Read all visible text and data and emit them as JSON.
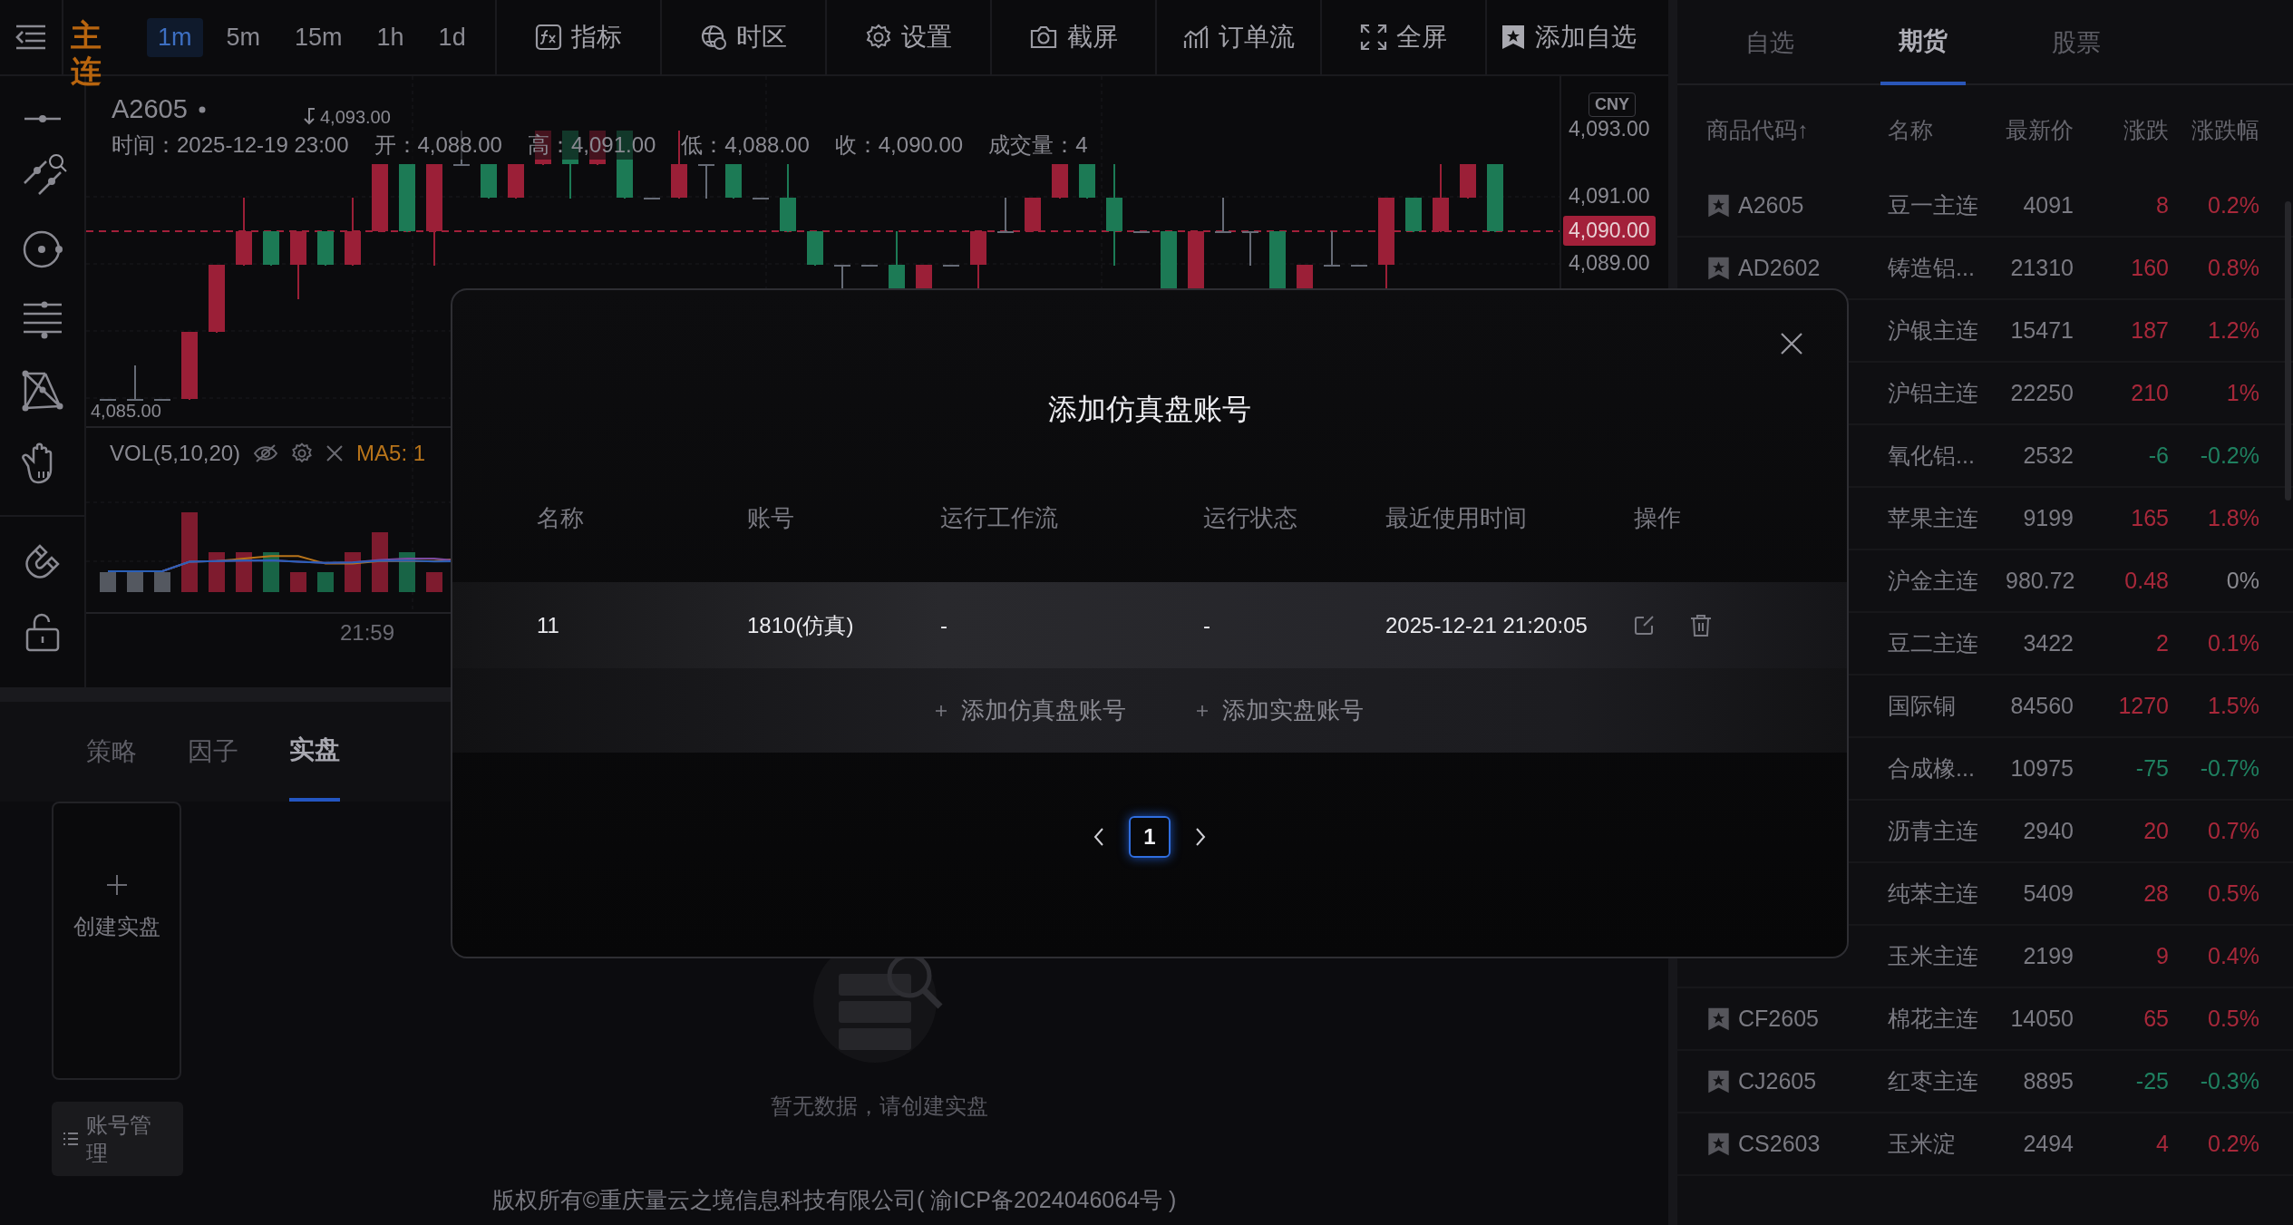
{
  "toolbar": {
    "contract_label": "主连",
    "intervals": [
      {
        "label": "1m",
        "selected": true
      },
      {
        "label": "5m",
        "selected": false
      },
      {
        "label": "15m",
        "selected": false
      },
      {
        "label": "1h",
        "selected": false
      },
      {
        "label": "1d",
        "selected": false
      }
    ],
    "tools": [
      {
        "kind": "indicator",
        "label": "指标"
      },
      {
        "kind": "timezone",
        "label": "时区"
      },
      {
        "kind": "settings",
        "label": "设置"
      },
      {
        "kind": "screenshot",
        "label": "截屏"
      },
      {
        "kind": "orderflow",
        "label": "订单流"
      },
      {
        "kind": "fullscreen",
        "label": "全屏"
      },
      {
        "kind": "favorite",
        "label": "添加自选"
      }
    ]
  },
  "chart": {
    "symbol": "A2605",
    "info": [
      {
        "label": "时间：",
        "value": "2025-12-19 23:00"
      },
      {
        "label": "开：",
        "value": "4,088.00"
      },
      {
        "label": "高：",
        "value": "4,091.00"
      },
      {
        "label": "低：",
        "value": "4,088.00"
      },
      {
        "label": "收：",
        "value": "4,090.00"
      },
      {
        "label": "成交量：",
        "value": "4"
      }
    ],
    "high_marker": "4,093.00",
    "low_marker": "4,085.00",
    "currency": "CNY",
    "price_labels": [
      {
        "price": "4,093.00"
      },
      {
        "price": "4,091.00"
      },
      {
        "price": "4,089.00"
      }
    ],
    "last_price": "4,090.00",
    "volume": {
      "title": "VOL(5,10,20)",
      "ma": "MA5: 1"
    },
    "time_label": "21:59"
  },
  "bottom": {
    "tabs": [
      {
        "label": "策略",
        "selected": false
      },
      {
        "label": "因子",
        "selected": false
      },
      {
        "label": "实盘",
        "selected": true
      }
    ],
    "create_card": "创建实盘",
    "account_button": "账号管理",
    "empty_text": "暂无数据，请创建实盘"
  },
  "footer": "版权所有©重庆量云之境信息科技有限公司( 渝ICP备2024046064号 )",
  "modal": {
    "title": "添加仿真盘账号",
    "columns": [
      "名称",
      "账号",
      "运行工作流",
      "运行状态",
      "最近使用时间",
      "操作"
    ],
    "rows": [
      {
        "name": "11",
        "account": "1810(仿真)",
        "workflow": "-",
        "status": "-",
        "last_used": "2025-12-21 21:20:05"
      }
    ],
    "add_actions": [
      "添加仿真盘账号",
      "添加实盘账号"
    ],
    "pages": [
      {
        "label": "1",
        "selected": true
      }
    ]
  },
  "watchlist": {
    "tabs": [
      {
        "label": "自选",
        "selected": false
      },
      {
        "label": "期货",
        "selected": true
      },
      {
        "label": "股票",
        "selected": false
      }
    ],
    "columns": [
      "商品代码↑",
      "名称",
      "最新价",
      "涨跌",
      "涨跌幅"
    ],
    "rows": [
      {
        "code": "A2605",
        "name": "豆一主连",
        "price": "4091",
        "change": "8",
        "pct": "0.2%",
        "color": "#a8283a",
        "flat": false
      },
      {
        "code": "AD2602",
        "name": "铸造铝...",
        "price": "21310",
        "change": "160",
        "pct": "0.8%",
        "color": "#a8283a",
        "flat": false
      },
      {
        "name": "沪银主连",
        "price": "15471",
        "change": "187",
        "pct": "1.2%",
        "color": "#a8283a",
        "flat": false
      },
      {
        "name": "沪铝主连",
        "price": "22250",
        "change": "210",
        "pct": "1%",
        "color": "#a8283a",
        "flat": false
      },
      {
        "name": "氧化铝...",
        "price": "2532",
        "change": "-6",
        "pct": "-0.2%",
        "color": "#1f8060",
        "flat": false
      },
      {
        "name": "苹果主连",
        "price": "9199",
        "change": "165",
        "pct": "1.8%",
        "color": "#a8283a",
        "flat": false
      },
      {
        "name": "沪金主连",
        "price": "980.72",
        "change": "0.48",
        "pct": "0%",
        "color": "#a8283a",
        "flat": true
      },
      {
        "name": "豆二主连",
        "price": "3422",
        "change": "2",
        "pct": "0.1%",
        "color": "#a8283a",
        "flat": false
      },
      {
        "name": "国际铜",
        "price": "84560",
        "change": "1270",
        "pct": "1.5%",
        "color": "#a8283a",
        "flat": false
      },
      {
        "name": "合成橡...",
        "price": "10975",
        "change": "-75",
        "pct": "-0.7%",
        "color": "#1f8060",
        "flat": false
      },
      {
        "name": "沥青主连",
        "price": "2940",
        "change": "20",
        "pct": "0.7%",
        "color": "#a8283a",
        "flat": false
      },
      {
        "name": "纯苯主连",
        "price": "5409",
        "change": "28",
        "pct": "0.5%",
        "color": "#a8283a",
        "flat": false
      },
      {
        "name": "玉米主连",
        "price": "2199",
        "change": "9",
        "pct": "0.4%",
        "color": "#a8283a",
        "flat": false
      },
      {
        "code": "CF2605",
        "name": "棉花主连",
        "price": "14050",
        "change": "65",
        "pct": "0.5%",
        "color": "#a8283a",
        "flat": false
      },
      {
        "code": "CJ2605",
        "name": "红枣主连",
        "price": "8895",
        "change": "-25",
        "pct": "-0.3%",
        "color": "#1f8060",
        "flat": false
      },
      {
        "code": "CS2603",
        "name": "玉米淀",
        "price": "2494",
        "change": "4",
        "pct": "0.2%",
        "color": "#a8283a",
        "flat": false
      }
    ]
  }
}
